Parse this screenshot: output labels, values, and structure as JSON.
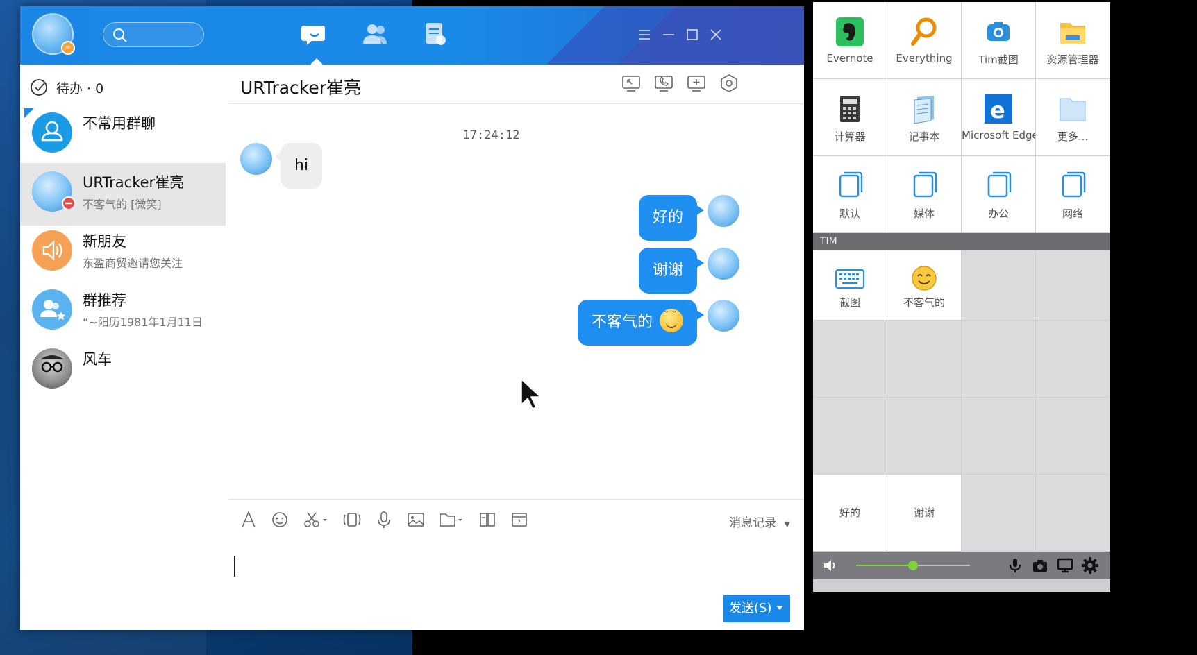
{
  "tim": {
    "search": {
      "placeholder": ""
    },
    "nav": [
      {
        "name": "messages-tab",
        "active": true
      },
      {
        "name": "contacts-tab",
        "active": false
      },
      {
        "name": "notes-tab",
        "active": false
      }
    ],
    "window_controls": [
      "menu-icon",
      "minimize-icon",
      "maximize-icon",
      "close-icon"
    ],
    "todo_label": "待办 · 0",
    "conversations": [
      {
        "name": "不常用群聊",
        "preview": "",
        "selected": false
      },
      {
        "name": "URTracker崔亮",
        "preview": "不客气的 [微笑]",
        "selected": true
      },
      {
        "name": "新朋友",
        "preview": "东盈商贸邀请您关注",
        "selected": false
      },
      {
        "name": "群推荐",
        "preview": "“~阳历1981年1月11日",
        "selected": false
      },
      {
        "name": "风车",
        "preview": "",
        "selected": false
      }
    ],
    "chat": {
      "title": "URTracker崔亮",
      "timestamp": "17:24:12",
      "messages": [
        {
          "direction": "in",
          "text": "hi"
        },
        {
          "direction": "out",
          "text": "好的"
        },
        {
          "direction": "out",
          "text": "谢谢"
        },
        {
          "direction": "out",
          "text": "不客气的",
          "emoji": "smile"
        }
      ],
      "history_label": "消息记录",
      "send_label": "发送",
      "send_shortcut": "(S)"
    },
    "colors": {
      "accent": "#1a88e8",
      "bubble_out": "#1e8ff0",
      "bubble_in": "#eeeeee"
    }
  },
  "launcher": {
    "rows": [
      [
        {
          "label": "Evernote",
          "icon": "evernote-icon"
        },
        {
          "label": "Everything",
          "icon": "magnifier-icon"
        },
        {
          "label": "Tim截图",
          "icon": "camera-icon"
        },
        {
          "label": "资源管理器",
          "icon": "folder-icon"
        }
      ],
      [
        {
          "label": "计算器",
          "icon": "calculator-icon"
        },
        {
          "label": "记事本",
          "icon": "notepad-icon"
        },
        {
          "label": "Microsoft Edge",
          "icon": "edge-icon"
        },
        {
          "label": "更多...",
          "icon": "folder-light-icon"
        }
      ],
      [
        {
          "label": "默认",
          "icon": "copy-icon"
        },
        {
          "label": "媒体",
          "icon": "copy-icon"
        },
        {
          "label": "办公",
          "icon": "copy-icon"
        },
        {
          "label": "网络",
          "icon": "copy-icon"
        }
      ]
    ],
    "section_title": "TIM",
    "tim_cells": [
      {
        "label": "截图",
        "icon": "keyboard-icon"
      },
      {
        "label": "不客气的",
        "icon": "smiley-icon"
      }
    ],
    "phrase_cells": [
      "好的",
      "谢谢"
    ],
    "volume_level": 0.5
  }
}
